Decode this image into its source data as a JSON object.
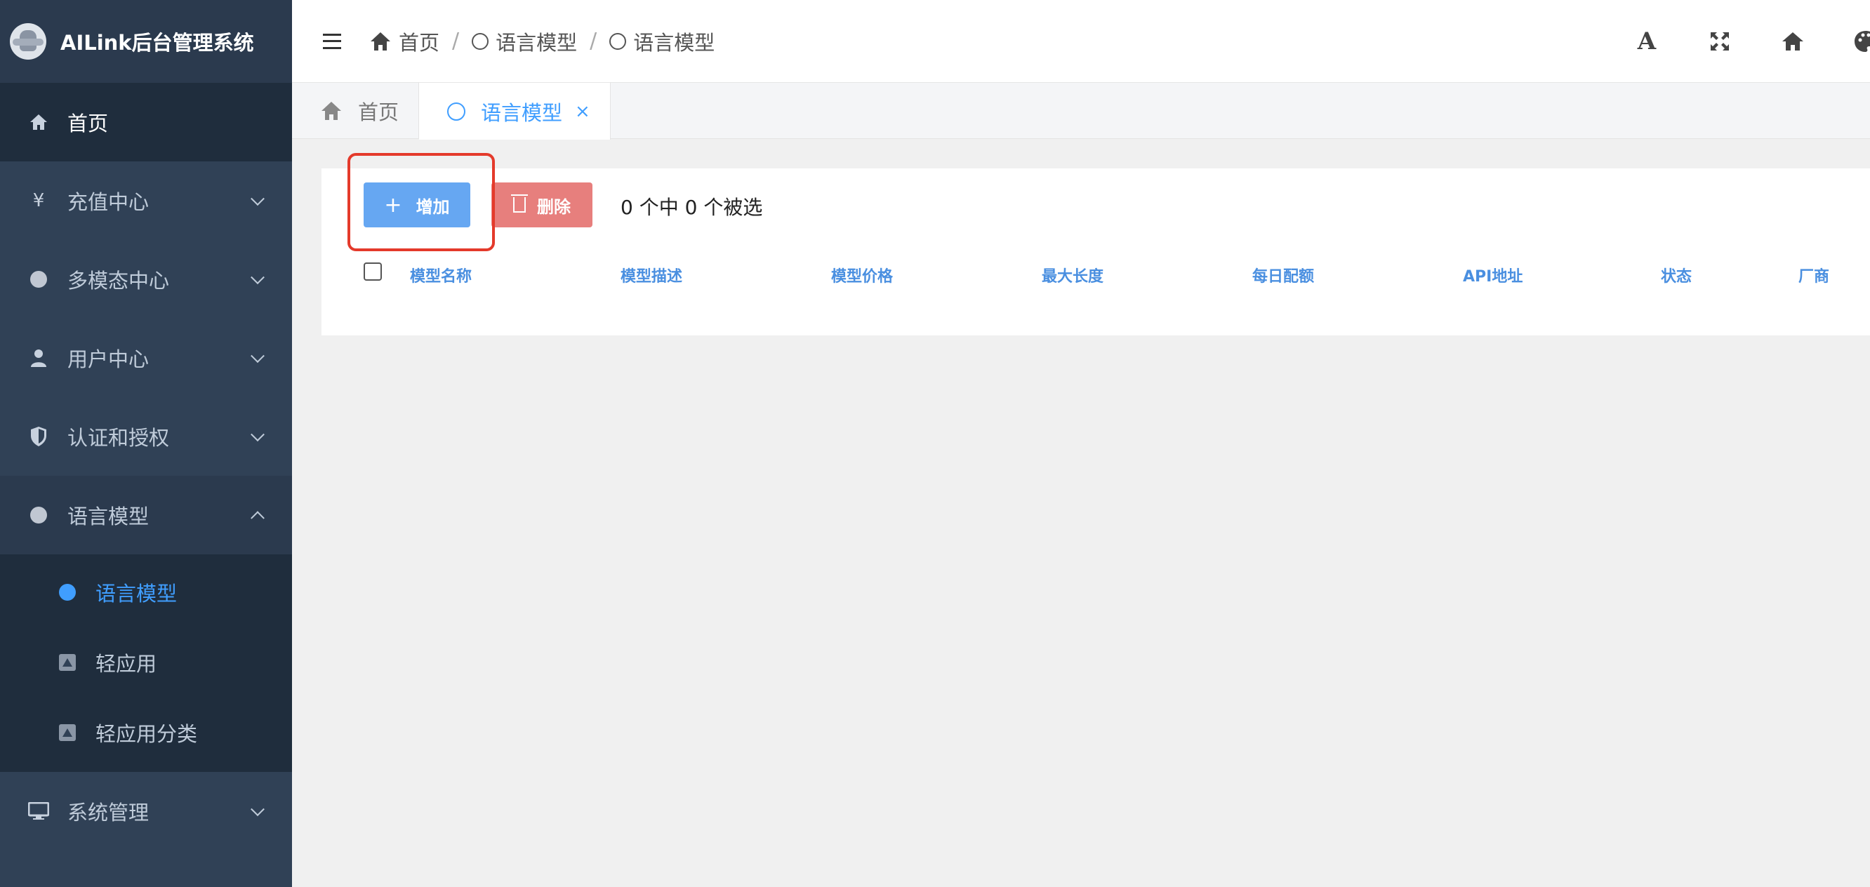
{
  "app": {
    "title": "AILink后台管理系统"
  },
  "sidebar": {
    "items": [
      {
        "label": "首页",
        "icon": "home-icon"
      },
      {
        "label": "充值中心",
        "icon": "yen-icon",
        "glyph": "¥"
      },
      {
        "label": "多模态中心",
        "icon": "circle-icon"
      },
      {
        "label": "用户中心",
        "icon": "user-icon"
      },
      {
        "label": "认证和授权",
        "icon": "shield-icon"
      },
      {
        "label": "语言模型",
        "icon": "circle-icon"
      },
      {
        "label": "系统管理",
        "icon": "monitor-icon"
      }
    ],
    "submenu": [
      {
        "label": "语言模型",
        "icon": "dot-icon",
        "active": true
      },
      {
        "label": "轻应用",
        "icon": "app-icon"
      },
      {
        "label": "轻应用分类",
        "icon": "app-icon"
      }
    ]
  },
  "breadcrumb": {
    "home": "首页",
    "level1": "语言模型",
    "level2": "语言模型",
    "separator": "/"
  },
  "header_tools": {
    "font_size_glyph": "A"
  },
  "tags": {
    "home": "首页",
    "active": "语言模型",
    "close": "×"
  },
  "toolbar": {
    "add_label": "增加",
    "add_plus": "+",
    "delete_label": "删除",
    "selection_text": "0 个中 0 个被选"
  },
  "table": {
    "columns": [
      "模型名称",
      "模型描述",
      "模型价格",
      "最大长度",
      "每日配额",
      "API地址",
      "状态",
      "厂商"
    ]
  },
  "colors": {
    "sidebar_bg": "#304156",
    "accent": "#409eff",
    "add_button": "#66a7f2",
    "delete_button": "#e77f7d",
    "highlight_box": "#e43a2b"
  }
}
